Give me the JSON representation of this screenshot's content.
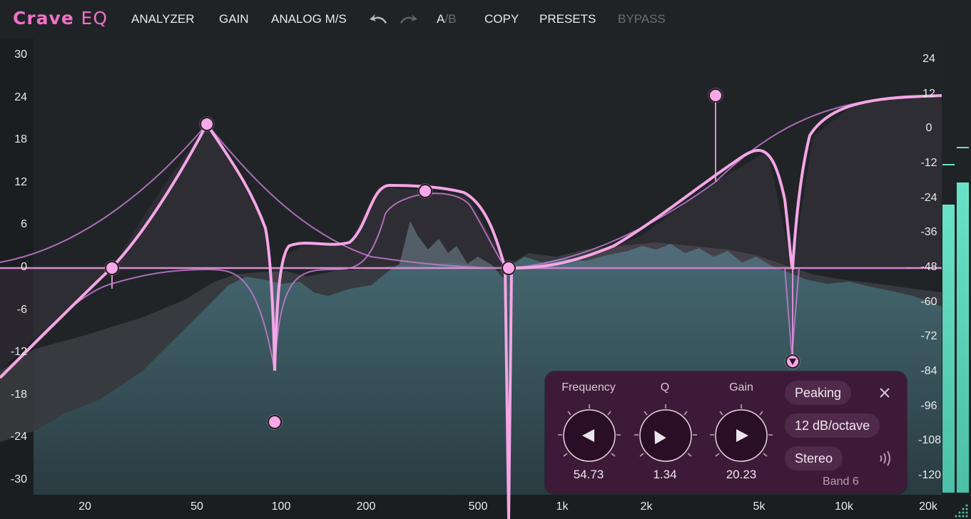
{
  "app": {
    "logo_main": "Crave",
    "logo_sub": "EQ"
  },
  "toolbar": {
    "analyzer": "ANALYZER",
    "gain": "GAIN",
    "analog_ms": "ANALOG M/S",
    "a": "A",
    "slash": "/",
    "b": "B",
    "copy": "COPY",
    "presets": "PRESETS",
    "bypass": "BYPASS"
  },
  "axes": {
    "y_left": [
      "30",
      "24",
      "18",
      "12",
      "6",
      "0",
      "-6",
      "-12",
      "-18",
      "-24",
      "-30"
    ],
    "y_right": [
      "24",
      "12",
      "0",
      "-12",
      "-24",
      "-36",
      "-48",
      "-60",
      "-72",
      "-84",
      "-96",
      "-108",
      "-120"
    ],
    "x": [
      "20",
      "50",
      "100",
      "200",
      "500",
      "1k",
      "2k",
      "5k",
      "10k",
      "20k"
    ]
  },
  "colors": {
    "curve": "#f4a6e6",
    "band_line": "#c47ad0",
    "analyzer": "#3f5e66",
    "meter": "#5fd9bf",
    "accent": "#f071c8"
  },
  "bands": [
    {
      "type": "high-pass",
      "freq_hz": 25,
      "gain_db": 0
    },
    {
      "type": "peaking",
      "freq_hz": 55,
      "gain_db": 20
    },
    {
      "type": "notch",
      "freq_hz": 97,
      "gain_db": -22
    },
    {
      "type": "peaking",
      "freq_hz": 330,
      "gain_db": 11
    },
    {
      "type": "low-pass",
      "freq_hz": 560,
      "gain_db": 0
    },
    {
      "type": "high-shelf",
      "freq_hz": 3200,
      "gain_db": 24
    },
    {
      "type": "notch",
      "freq_hz": 7000,
      "gain_db": -11
    }
  ],
  "panel": {
    "freq_label": "Frequency",
    "q_label": "Q",
    "gain_label": "Gain",
    "freq_value": "54.73",
    "q_value": "1.34",
    "gain_value": "20.23",
    "filter_type": "Peaking",
    "slope": "12 dB/octave",
    "channel": "Stereo",
    "band": "Band 6",
    "knob_icons": [
      "knob-frequency-icon",
      "knob-q-icon",
      "knob-gain-icon"
    ]
  },
  "meters": {
    "left_level": 0.65,
    "right_level": 0.7
  }
}
